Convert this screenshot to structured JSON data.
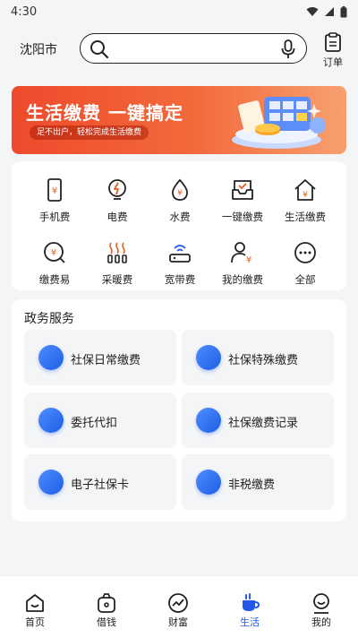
{
  "status_bar": {
    "time": "4:30"
  },
  "header": {
    "city": "沈阳市",
    "search_placeholder": "",
    "order_label": "订单"
  },
  "banner": {
    "title": "生活缴费 一键搞定",
    "subtitle": "足不出户，轻松完成生活缴费"
  },
  "quick_services": [
    {
      "label": "手机费",
      "icon": "phone-bill-icon"
    },
    {
      "label": "电费",
      "icon": "electricity-icon"
    },
    {
      "label": "水费",
      "icon": "water-drop-icon"
    },
    {
      "label": "一键缴费",
      "icon": "tray-check-icon"
    },
    {
      "label": "生活缴费",
      "icon": "house-yen-icon"
    },
    {
      "label": "缴费易",
      "icon": "yen-search-icon"
    },
    {
      "label": "采暖费",
      "icon": "heating-icon"
    },
    {
      "label": "宽带费",
      "icon": "broadband-icon"
    },
    {
      "label": "我的缴费",
      "icon": "user-yen-icon"
    },
    {
      "label": "全部",
      "icon": "more-dots-icon"
    }
  ],
  "gov_services": {
    "title": "政务服务",
    "items": [
      {
        "label": "社保日常缴费",
        "icon": "social-security-daily-icon"
      },
      {
        "label": "社保特殊缴费",
        "icon": "social-security-special-icon"
      },
      {
        "label": "委托代扣",
        "icon": "entrust-deduct-icon"
      },
      {
        "label": "社保缴费记录",
        "icon": "payment-record-icon"
      },
      {
        "label": "电子社保卡",
        "icon": "e-card-icon"
      },
      {
        "label": "非税缴费",
        "icon": "non-tax-icon"
      }
    ]
  },
  "tabbar": {
    "active": "生活",
    "accent": "#2558e8",
    "items": [
      {
        "label": "首页",
        "icon": "home-icon"
      },
      {
        "label": "借钱",
        "icon": "wallet-icon"
      },
      {
        "label": "财富",
        "icon": "wealth-chart-icon"
      },
      {
        "label": "生活",
        "icon": "life-cup-icon"
      },
      {
        "label": "我的",
        "icon": "profile-icon"
      }
    ]
  }
}
